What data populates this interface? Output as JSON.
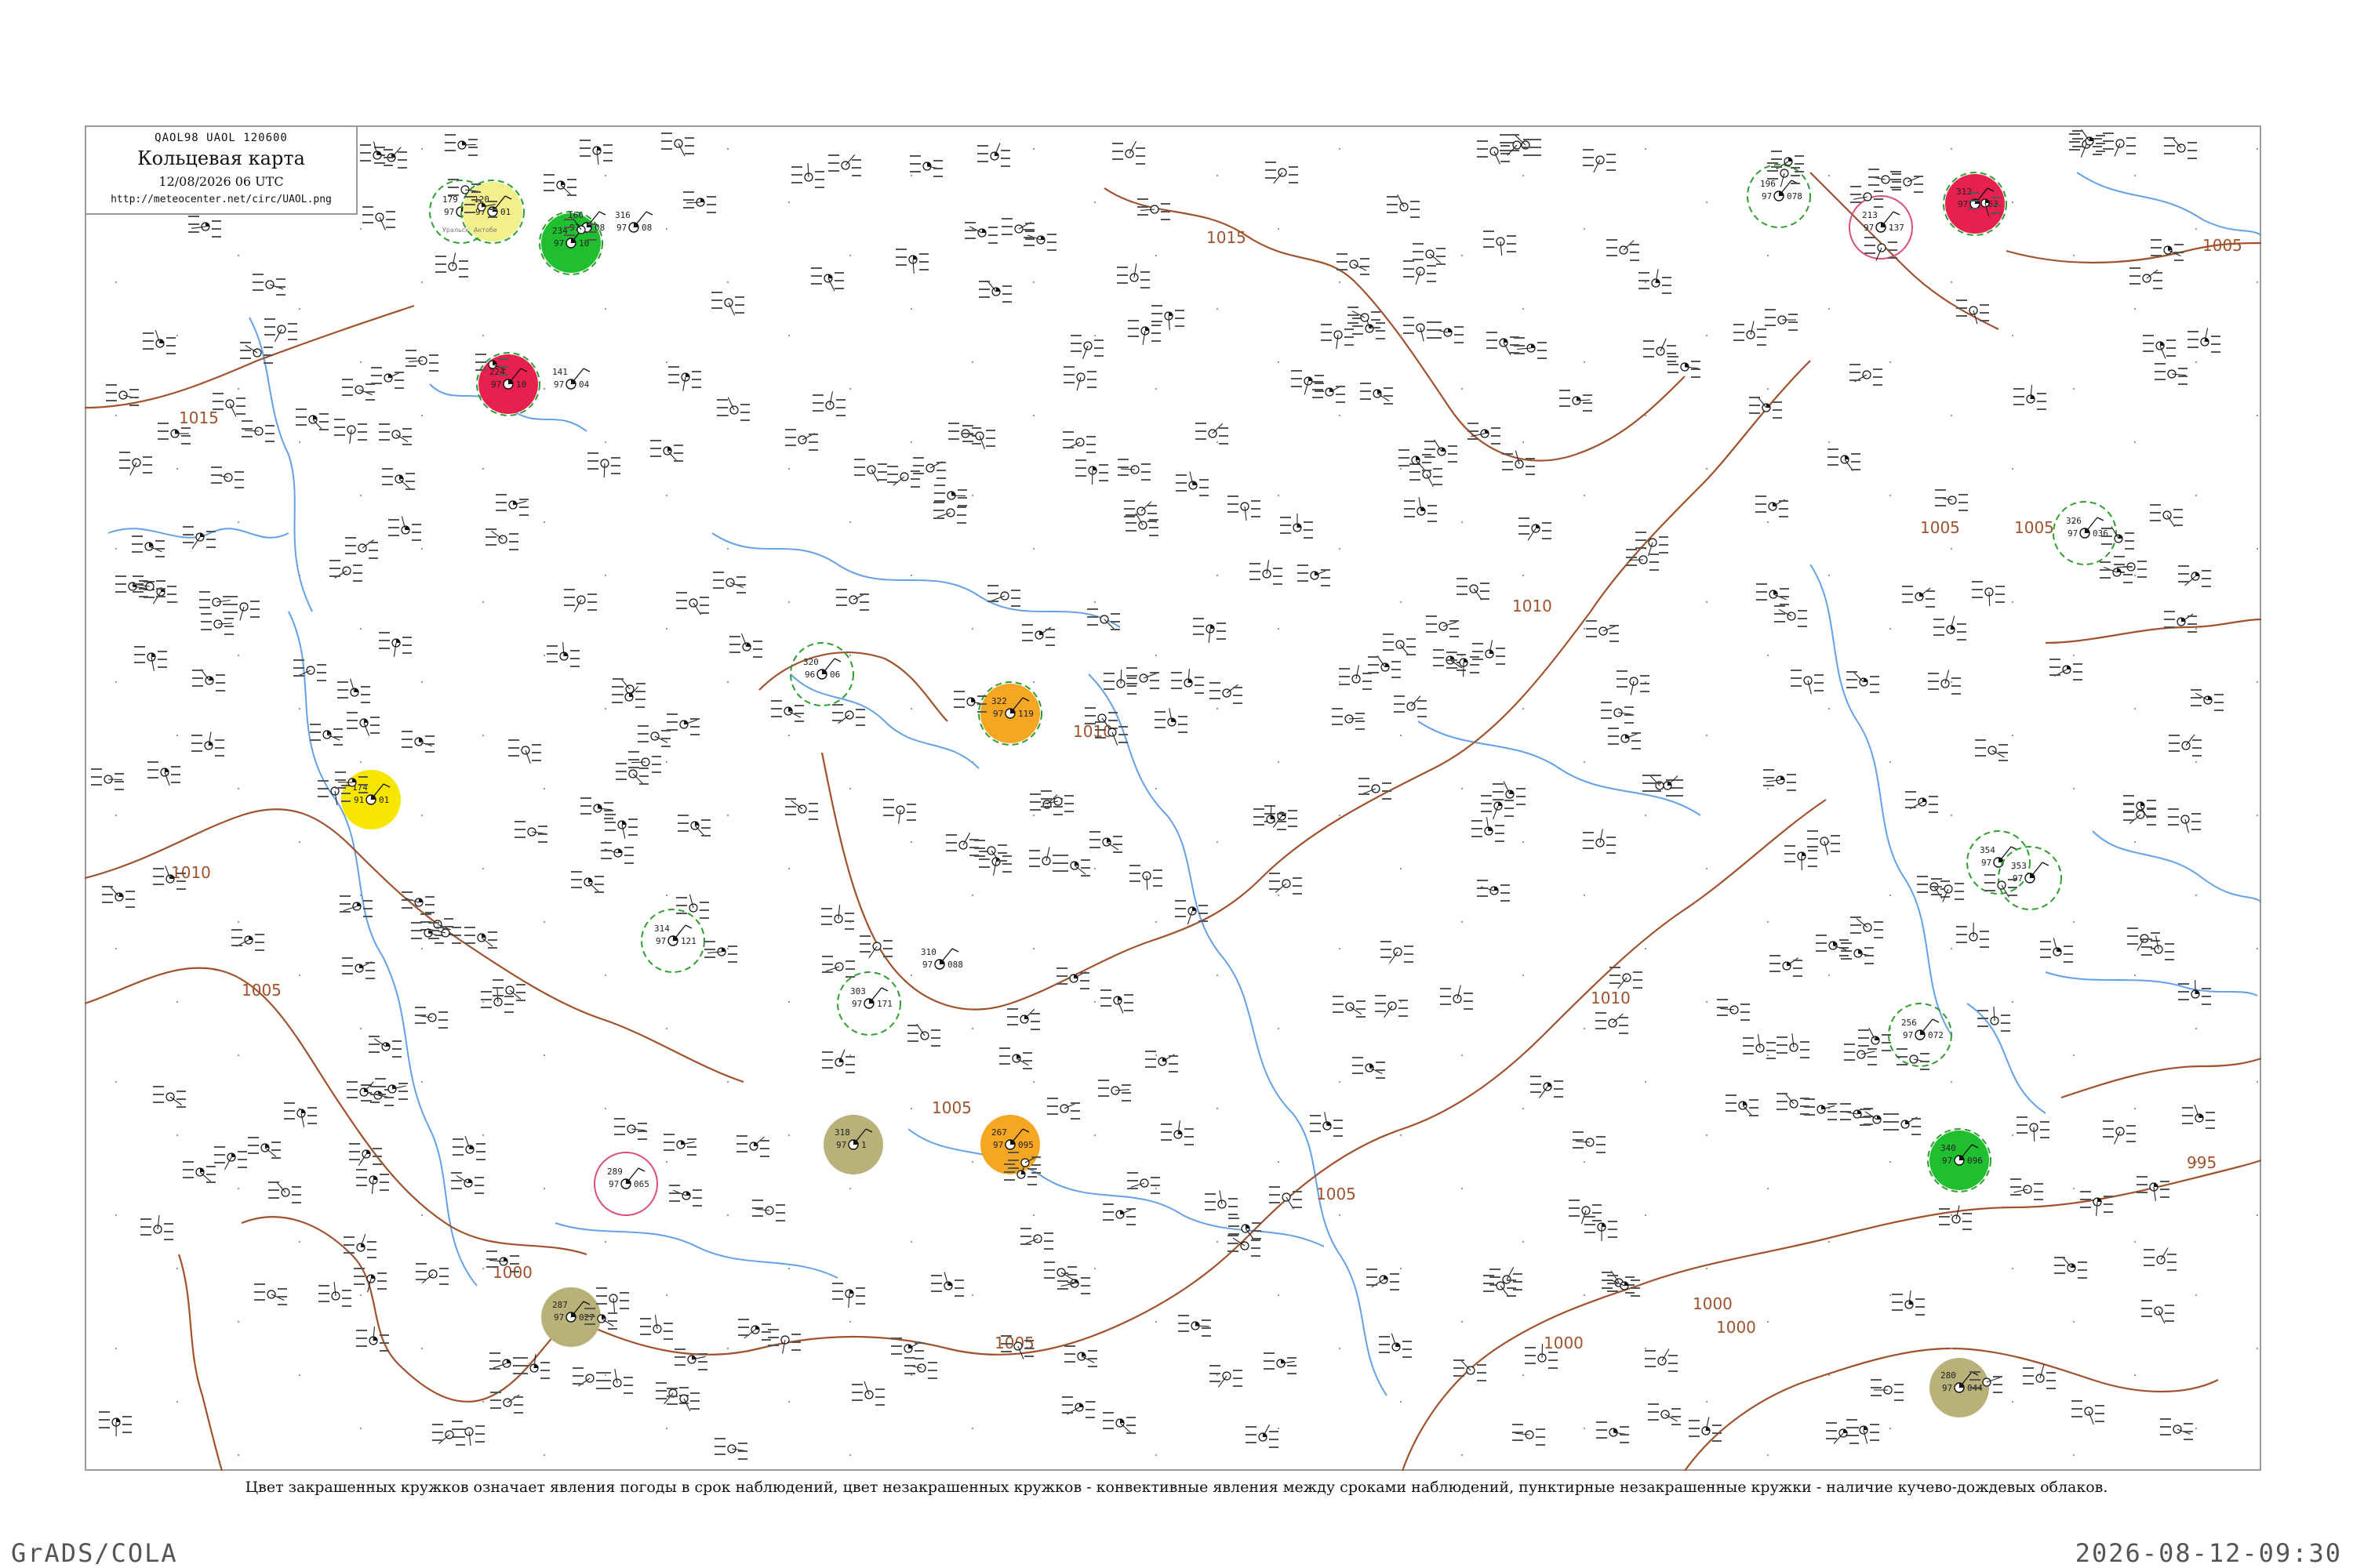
{
  "header": {
    "code": "QAOL98  UAOL  120600",
    "title": "Кольцевая карта",
    "datetime": "12/08/2026 06 UTC",
    "url": "http://meteocenter.net/circ/UAOL.png"
  },
  "caption": "Цвет закрашенных кружков означает явления погоды в срок наблюдений, цвет незакрашенных кружков - конвективные явления между сроками наблюдений, пунктирные незакрашенные кружки - наличие кучево-дождевых облаков.",
  "footer": {
    "left": "GrADS/COLA",
    "right": "2026-08-12-09:30"
  },
  "colors": {
    "isobar": "#a0522d",
    "river": "#4a90e2",
    "cb_dashed": "#2e9e2e",
    "convective_ring": "#d94f7a",
    "thunderstorm_fill": "#e8204f",
    "rain_fill": "#1fbf2f",
    "shower_fill": "#f5a623",
    "haze_fill": "#b8b27a",
    "fog_fill": "#f7e600"
  },
  "isobar_labels": [
    "1015",
    "1010",
    "1005",
    "1000",
    "995",
    "1015",
    "1010",
    "1010",
    "1005",
    "1005",
    "1005",
    "1005",
    "1000",
    "1000",
    "1000",
    "1005",
    "1010",
    "1005"
  ],
  "stations": [
    {
      "a": "179",
      "b": "97",
      "c": "126",
      "name": "Уральск",
      "fill": "",
      "ring": "cb"
    },
    {
      "a": "120",
      "b": "97",
      "c": "01",
      "name": "Актобе",
      "fill": "fog_pale",
      "ring": "cb"
    },
    {
      "a": "234",
      "b": "97",
      "c": "10",
      "name": "",
      "fill": "rain",
      "ring": "cb"
    },
    {
      "a": "166",
      "b": "97",
      "c": "08",
      "name": "",
      "fill": "",
      "ring": "none"
    },
    {
      "a": "316",
      "b": "97",
      "c": "08",
      "name": "",
      "fill": "",
      "ring": "none"
    },
    {
      "a": "224",
      "b": "97",
      "c": "10",
      "name": "",
      "fill": "thunder",
      "ring": "cb"
    },
    {
      "a": "141",
      "b": "97",
      "c": "04",
      "name": "",
      "fill": "",
      "ring": "none"
    },
    {
      "a": "320",
      "b": "96",
      "c": "06",
      "name": "",
      "fill": "",
      "ring": "cb"
    },
    {
      "a": "322",
      "b": "97",
      "c": "119",
      "name": "",
      "fill": "shower",
      "ring": "cb"
    },
    {
      "a": "174",
      "b": "91",
      "c": "01",
      "name": "",
      "fill": "fog",
      "ring": "none"
    },
    {
      "a": "314",
      "b": "97",
      "c": "121",
      "name": "",
      "fill": "",
      "ring": "cb"
    },
    {
      "a": "303",
      "b": "97",
      "c": "171",
      "name": "",
      "fill": "",
      "ring": "cb"
    },
    {
      "a": "310",
      "b": "97",
      "c": "088",
      "name": "",
      "fill": "",
      "ring": "none"
    },
    {
      "a": "267",
      "b": "97",
      "c": "095",
      "name": "",
      "fill": "shower",
      "ring": "none"
    },
    {
      "a": "318",
      "b": "97",
      "c": "1",
      "name": "",
      "fill": "haze",
      "ring": "none"
    },
    {
      "a": "287",
      "b": "97",
      "c": "027",
      "name": "",
      "fill": "haze",
      "ring": "none"
    },
    {
      "a": "213",
      "b": "97",
      "c": "137",
      "name": "",
      "fill": "",
      "ring": "conv"
    },
    {
      "a": "196",
      "b": "97",
      "c": "078",
      "name": "",
      "fill": "",
      "ring": "cb"
    },
    {
      "a": "312",
      "b": "97",
      "c": "063",
      "name": "",
      "fill": "thunder",
      "ring": "cb"
    },
    {
      "a": "326",
      "b": "97",
      "c": "036",
      "name": "",
      "fill": "",
      "ring": "cb"
    },
    {
      "a": "256",
      "b": "97",
      "c": "072",
      "name": "",
      "fill": "",
      "ring": "cb"
    },
    {
      "a": "340",
      "b": "97",
      "c": "096",
      "name": "",
      "fill": "rain",
      "ring": "cb"
    },
    {
      "a": "280",
      "b": "97",
      "c": "044",
      "name": "",
      "fill": "haze",
      "ring": "none"
    },
    {
      "a": "289",
      "b": "97",
      "c": "065",
      "name": "",
      "fill": "",
      "ring": "conv"
    },
    {
      "a": "354",
      "b": "97",
      "c": "",
      "name": "",
      "fill": "",
      "ring": "cb"
    },
    {
      "a": "353",
      "b": "97",
      "c": "",
      "name": "",
      "fill": "",
      "ring": "cb"
    }
  ]
}
